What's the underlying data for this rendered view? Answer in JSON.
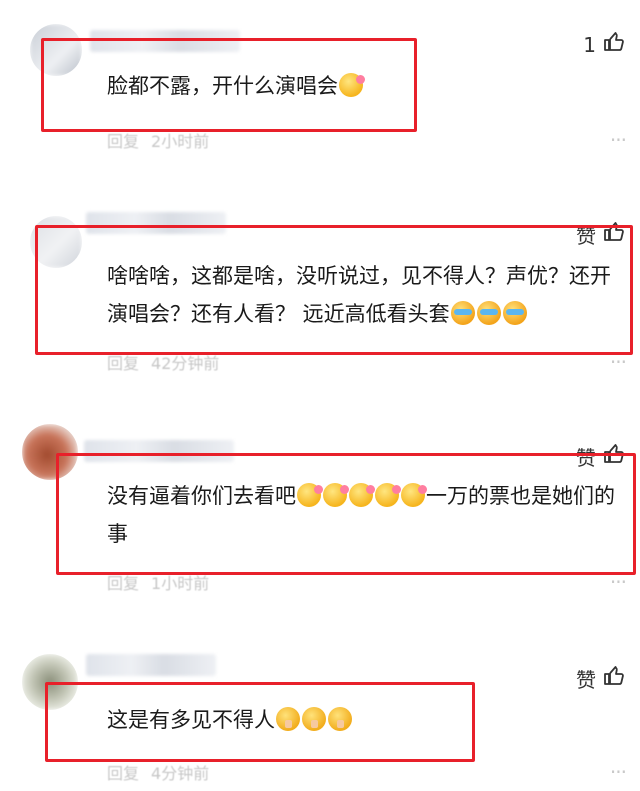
{
  "comments": [
    {
      "text_before": "脸都不露，开什么演唱会",
      "emojis": [
        "hot"
      ],
      "text_after": "",
      "like_label": "1",
      "reply_label": "回复",
      "time": "2小时前",
      "more": "···"
    },
    {
      "text_before": "啥啥啥，这都是啥，没听说过，见不得人？声优？还开演唱会？还有人看？ 远近高低看头套",
      "emojis": [
        "cry",
        "cry",
        "cry"
      ],
      "text_after": "",
      "like_label": "赞",
      "reply_label": "回复",
      "time": "42分钟前",
      "more": "···"
    },
    {
      "text_before": "没有逼着你们去看吧",
      "emojis": [
        "hot",
        "hot",
        "hot",
        "hot",
        "hot"
      ],
      "text_after": "一万的票也是她们的事",
      "like_label": "赞",
      "reply_label": "回复",
      "time": "1小时前",
      "more": "···"
    },
    {
      "text_before": "这是有多见不得人",
      "emojis": [
        "shh",
        "shh",
        "shh"
      ],
      "text_after": "",
      "like_label": "赞",
      "reply_label": "回复",
      "time": "4分钟前",
      "more": "···"
    }
  ],
  "colors": {
    "highlight": "#e8202a",
    "meta": "#999999"
  },
  "icons": {
    "like": "thumbs-up-icon"
  }
}
